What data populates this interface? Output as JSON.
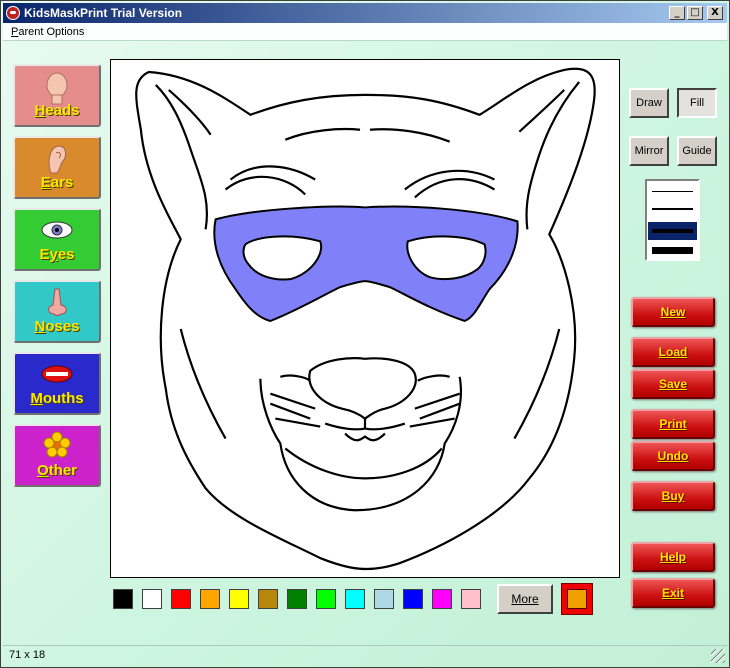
{
  "window": {
    "title": "KidsMaskPrint Trial Version",
    "btn_min": "_",
    "btn_max": "□",
    "btn_close": "X"
  },
  "menu": {
    "parent_options_first": "P",
    "parent_options_rest": "arent Options"
  },
  "categories": [
    {
      "key": "H",
      "rest": "eads",
      "color": "#e58c8c",
      "icon": "head-icon"
    },
    {
      "key": "E",
      "rest": "ars",
      "color": "#d98a2c",
      "icon": "ear-icon"
    },
    {
      "pre": "E",
      "key": "y",
      "rest": "es",
      "color": "#33cc33",
      "icon": "eye-icon"
    },
    {
      "key": "N",
      "rest": "oses",
      "color": "#33c8c8",
      "icon": "nose-icon"
    },
    {
      "key": "M",
      "rest": "ouths",
      "color": "#2a2acc",
      "icon": "mouth-icon"
    },
    {
      "key": "O",
      "rest": "ther",
      "color": "#cc22cc",
      "icon": "flower-icon"
    }
  ],
  "tools": {
    "draw": "Draw",
    "fill": "Fill",
    "mirror": "Mirror",
    "guide": "Guide",
    "selected": "fill"
  },
  "line_widths": {
    "selected_index": 2
  },
  "actions": {
    "new": "New",
    "load": "Load",
    "save": "Save",
    "print": "Print",
    "undo": "Undo",
    "buy": "Buy",
    "help": "Help",
    "exit": "Exit"
  },
  "palette": [
    "#000000",
    "#ffffff",
    "#ff0000",
    "#ffa500",
    "#ffff00",
    "#b8860b",
    "#008000",
    "#00ff00",
    "#00ffff",
    "#add8e6",
    "#0000ff",
    "#ff00ff",
    "#ffc0cb"
  ],
  "more_label": "More",
  "current_color": "#eea000",
  "mask_fill_color": "#8080f8",
  "status": {
    "text": "71 x 18"
  }
}
